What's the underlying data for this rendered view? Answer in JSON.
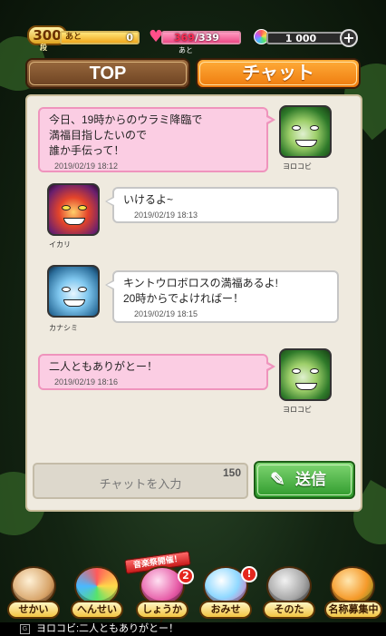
{
  "status": {
    "rank_value": "300",
    "rank_sub": "段",
    "exp_label": "あと",
    "exp_remaining": "0",
    "exp_fill_fraction": 1.0,
    "stamina_current": "369",
    "stamina_max": "/339",
    "stamina_sub": "あと",
    "stamina_fill_fraction": 1.0,
    "orbs": "1 000"
  },
  "tabs": [
    {
      "label": "TOP",
      "active": false
    },
    {
      "label": "チャット",
      "active": true
    }
  ],
  "messages": [
    {
      "sender": "ヨロコビ",
      "text": [
        "今日、19時からのウラミ降臨で",
        "満福目指したいので",
        "誰か手伝って！"
      ],
      "time": "2019/02/19 18:12",
      "own": true
    },
    {
      "sender": "イカリ",
      "text": [
        "いけるよ~"
      ],
      "time": "2019/02/19 18:13",
      "own": false
    },
    {
      "sender": "カナシミ",
      "text": [
        "キントウロボロスの満福あるよ!",
        "20時からでよければー！"
      ],
      "time": "2019/02/19 18:15",
      "own": false
    },
    {
      "sender": "ヨロコビ",
      "text": [
        "二人ともありがとー！"
      ],
      "time": "2019/02/19 18:16",
      "own": true
    }
  ],
  "input": {
    "placeholder": "チャットを入力",
    "char_limit": "150"
  },
  "send_button": {
    "label": "送信"
  },
  "nav": {
    "event_ribbon": "音楽祭開催！",
    "items": [
      {
        "label": "せかい",
        "icon": "world-scroll-icon",
        "badge": ""
      },
      {
        "label": "へんせい",
        "icon": "party-formation-icon",
        "badge": ""
      },
      {
        "label": "しょうかん",
        "icon": "gacha-summon-icon",
        "badge": "2"
      },
      {
        "label": "おみせ",
        "icon": "shop-icon",
        "badge": "!"
      },
      {
        "label": "そのた",
        "icon": "tools-icon",
        "badge": ""
      },
      {
        "label": "名称募集中",
        "icon": "mascot-icon",
        "badge": ""
      }
    ]
  },
  "ticker": {
    "text": "ヨロコビ:二人ともありがとー！"
  },
  "colors": {
    "accent_orange": "#ee7a0d",
    "pink_bubble": "#fbcde3",
    "send_green": "#2f9a2c"
  }
}
